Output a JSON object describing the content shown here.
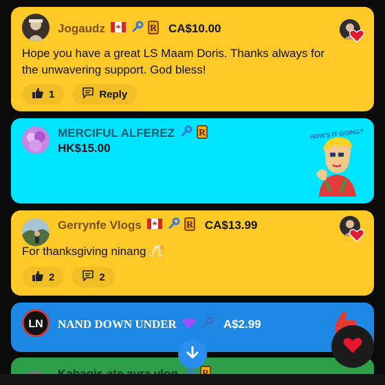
{
  "colors": {
    "yellow_card": "#ffca28",
    "cyan_card": "#00e5ff",
    "blue_card": "#1e88e5",
    "green_card": "#2e9e4a",
    "name_brown": "#7a4f12",
    "name_teal": "#005a6b",
    "name_white": "#ffffff",
    "fab_blue": "#2a8df0"
  },
  "messages": [
    {
      "name": "Jogaudz",
      "amount": "CA$10.00",
      "badges": [
        "canada-flag",
        "wrench-icon",
        "r-badge"
      ],
      "text": "Hope you have a great LS Maam Doris. Thanks always for the unwavering support. God bless!",
      "like_count": "1",
      "reply_label": "Reply"
    },
    {
      "name": "MERCIFUL ALFEREZ",
      "amount": "HK$15.00",
      "badges": [
        "wrench-icon",
        "r-badge"
      ],
      "sticker_text": "HOW'S IT GOING?"
    },
    {
      "name": "Gerrynfe Vlogs",
      "amount": "CA$13.99",
      "badges": [
        "canada-flag",
        "wrench-icon",
        "r-badge"
      ],
      "text": "For thanksgiving ninang 🥂",
      "like_count": "2",
      "reply_count": "2"
    },
    {
      "name": "NAND DOWN UNDER",
      "amount": "A$2.99",
      "badges": [
        "purple-heart",
        "wrench-icon"
      ]
    },
    {
      "name": "Kabagis ate ayra vlog",
      "badges": [
        "wrench-icon",
        "r-badge"
      ]
    }
  ],
  "icons": {
    "down": "arrow-down-icon",
    "heart": "heart-icon"
  }
}
